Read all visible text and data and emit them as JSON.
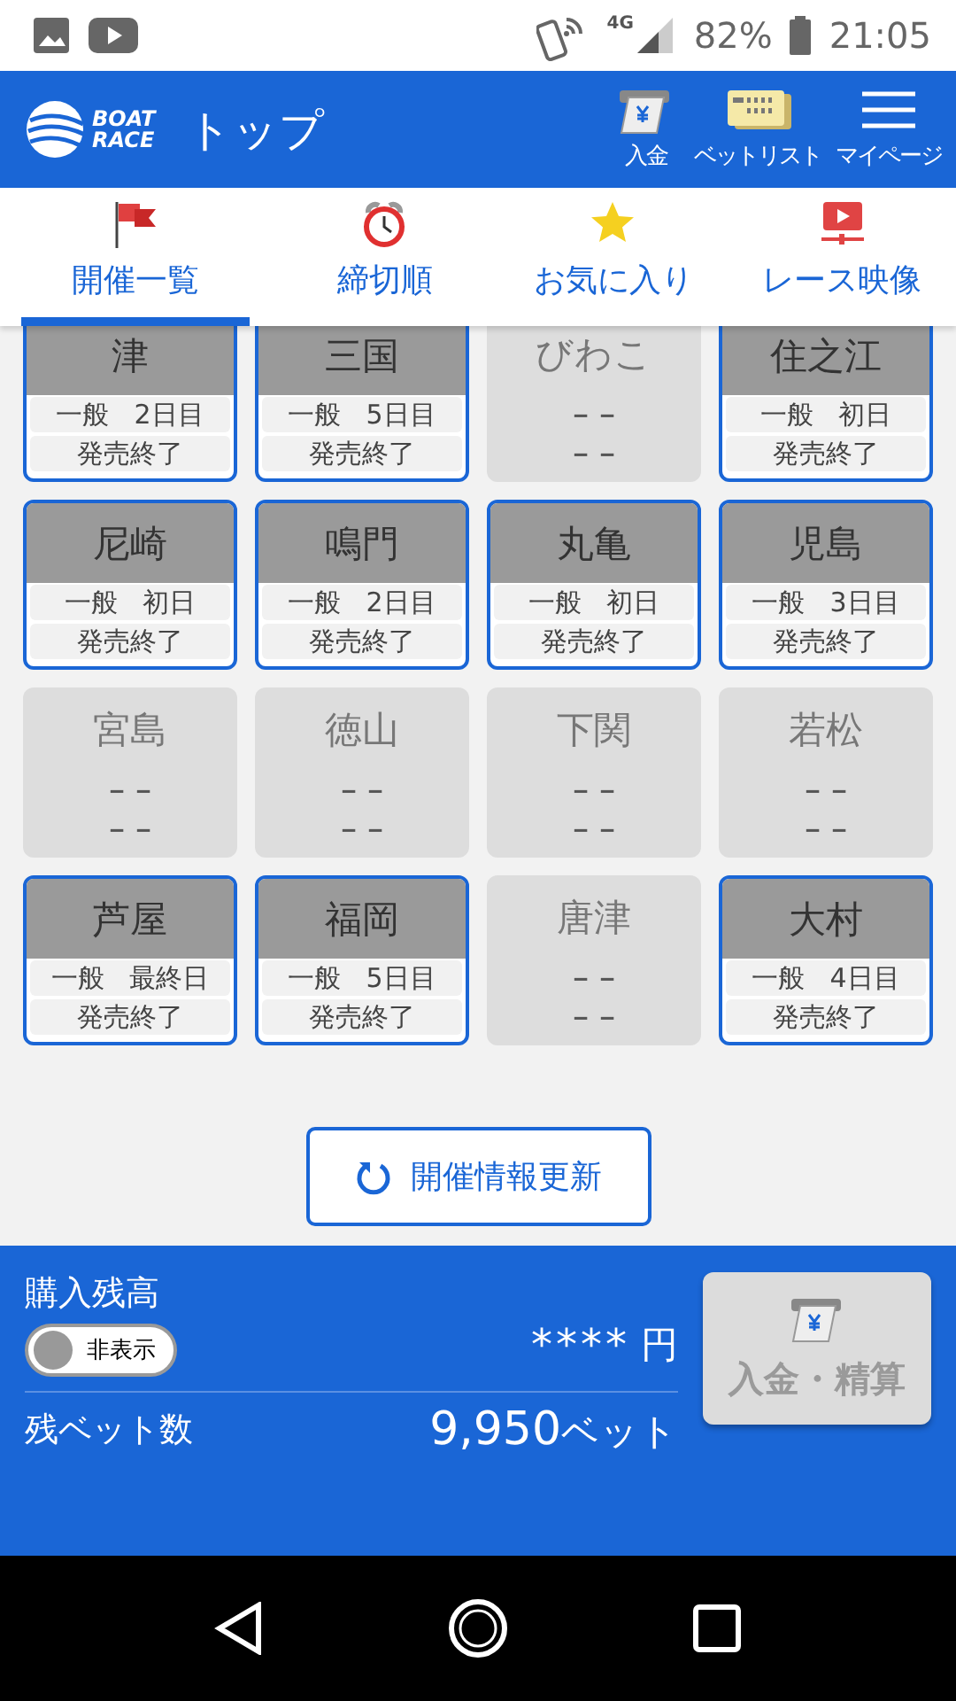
{
  "status_bar": {
    "network": "4G",
    "battery": "82%",
    "time": "21:05"
  },
  "header": {
    "logo_line1": "BOAT",
    "logo_line2": "RACE",
    "title": "トップ",
    "actions": [
      {
        "kind": "deposit",
        "label": "入金"
      },
      {
        "kind": "betlist",
        "label": "ベットリスト"
      },
      {
        "kind": "menu",
        "label": "マイページ"
      }
    ]
  },
  "tabs": [
    {
      "kind": "flag",
      "label": "開催一覧",
      "selected": true
    },
    {
      "kind": "clock",
      "label": "締切順",
      "selected": false
    },
    {
      "kind": "star",
      "label": "お気に入り",
      "selected": false
    },
    {
      "kind": "video",
      "label": "レース映像",
      "selected": false
    }
  ],
  "venues": [
    {
      "name": "津",
      "active": true,
      "grade": "一般",
      "day": "2日目",
      "sales": "発売終了"
    },
    {
      "name": "三国",
      "active": true,
      "grade": "一般",
      "day": "5日目",
      "sales": "発売終了"
    },
    {
      "name": "びわこ",
      "active": false,
      "grade": "－－",
      "sales": "－－"
    },
    {
      "name": "住之江",
      "active": true,
      "grade": "一般",
      "day": "初日",
      "sales": "発売終了"
    },
    {
      "name": "尼崎",
      "active": true,
      "grade": "一般",
      "day": "初日",
      "sales": "発売終了"
    },
    {
      "name": "鳴門",
      "active": true,
      "grade": "一般",
      "day": "2日目",
      "sales": "発売終了"
    },
    {
      "name": "丸亀",
      "active": true,
      "grade": "一般",
      "day": "初日",
      "sales": "発売終了"
    },
    {
      "name": "児島",
      "active": true,
      "grade": "一般",
      "day": "3日目",
      "sales": "発売終了"
    },
    {
      "name": "宮島",
      "active": false,
      "grade": "－－",
      "sales": "－－"
    },
    {
      "name": "徳山",
      "active": false,
      "grade": "－－",
      "sales": "－－"
    },
    {
      "name": "下関",
      "active": false,
      "grade": "－－",
      "sales": "－－"
    },
    {
      "name": "若松",
      "active": false,
      "grade": "－－",
      "sales": "－－"
    },
    {
      "name": "芦屋",
      "active": true,
      "grade": "一般",
      "day": "最終日",
      "sales": "発売終了"
    },
    {
      "name": "福岡",
      "active": true,
      "grade": "一般",
      "day": "5日目",
      "sales": "発売終了"
    },
    {
      "name": "唐津",
      "active": false,
      "grade": "－－",
      "sales": "－－"
    },
    {
      "name": "大村",
      "active": true,
      "grade": "一般",
      "day": "4日目",
      "sales": "発売終了"
    }
  ],
  "refresh_button": "開催情報更新",
  "wallet": {
    "balance_label": "購入残高",
    "toggle": {
      "label": "非表示",
      "on": false
    },
    "balance": "****",
    "currency": "円",
    "bets_label": "残ベット数",
    "bets_value": "9,950",
    "bets_unit": "ベット",
    "deposit_button": {
      "label": "入金・精算",
      "disabled": true
    }
  }
}
